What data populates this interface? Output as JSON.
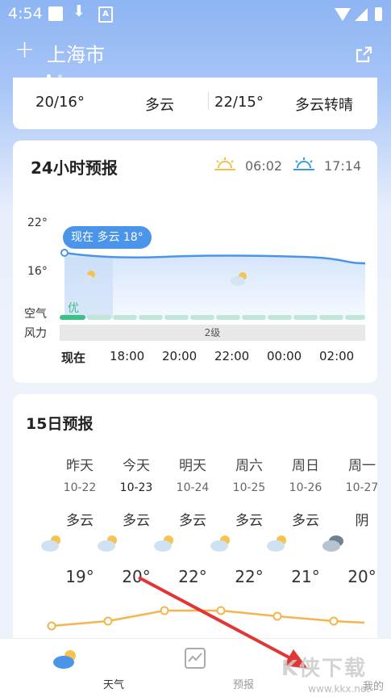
{
  "status": {
    "time": "4:54"
  },
  "header": {
    "city": "上海市"
  },
  "summary": {
    "today_temp": "20/16°",
    "today_cond": "多云",
    "tomorrow_temp": "22/15°",
    "tomorrow_cond": "多云转晴"
  },
  "hourly": {
    "title": "24小时预报",
    "sunrise": "06:02",
    "sunset": "17:14",
    "y_high": "22°",
    "y_low": "16°",
    "aq_label": "空气",
    "wind_label": "风力",
    "aq_value": "优",
    "wind_value": "2级",
    "now_badge": "现在 多云 18°",
    "times": [
      "现在",
      "18:00",
      "20:00",
      "22:00",
      "00:00",
      "02:00"
    ]
  },
  "daily": {
    "title": "15日预报",
    "days": [
      {
        "day": "昨天",
        "date": "10-22",
        "cond": "多云",
        "icon": "partly-cloudy-icon",
        "temp": "19°"
      },
      {
        "day": "今天",
        "date": "10-23",
        "cond": "多云",
        "icon": "partly-cloudy-icon",
        "temp": "20°"
      },
      {
        "day": "明天",
        "date": "10-24",
        "cond": "多云",
        "icon": "partly-cloudy-icon",
        "temp": "22°"
      },
      {
        "day": "周六",
        "date": "10-25",
        "cond": "多云",
        "icon": "partly-cloudy-icon",
        "temp": "22°"
      },
      {
        "day": "周日",
        "date": "10-26",
        "cond": "多云",
        "icon": "partly-cloudy-icon",
        "temp": "21°"
      },
      {
        "day": "周一",
        "date": "10-27",
        "cond": "阴",
        "icon": "overcast-icon",
        "temp": "20°"
      }
    ]
  },
  "nav": {
    "weather": "天气",
    "forecast": "预报",
    "mine": "我的"
  },
  "watermark": {
    "text": "www.kkx.net",
    "logo": "K侠下载"
  },
  "colors": {
    "accent": "#4a95ea",
    "line": "#f5b44d",
    "aq_good": "#3dbf88"
  }
}
